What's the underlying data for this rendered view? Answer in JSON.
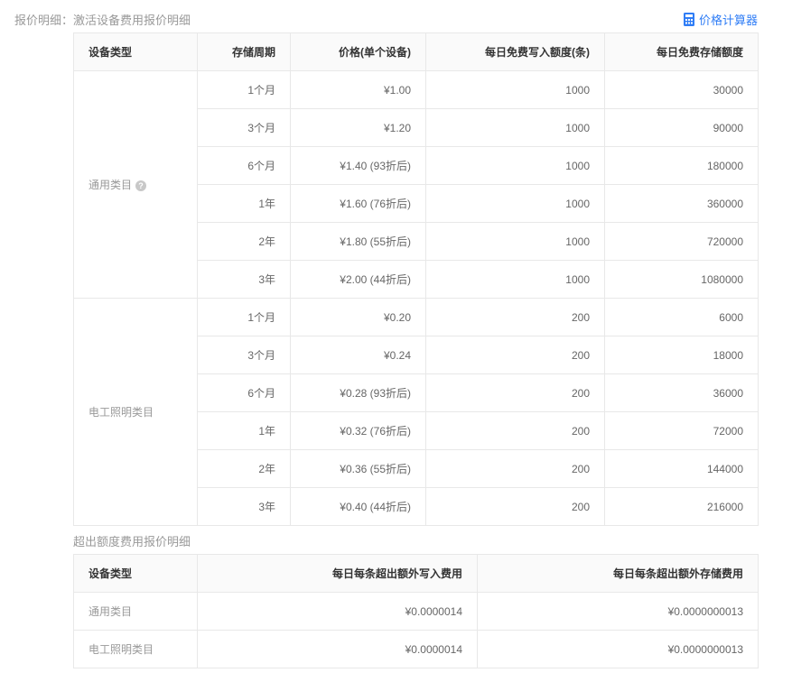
{
  "header": {
    "label": "报价明细：激活设备费用报价明细",
    "calculator": "价格计算器",
    "calculator_icon": "calculator-icon",
    "accent": "#2f7df6"
  },
  "main_table": {
    "columns": [
      "设备类型",
      "存储周期",
      "价格(单个设备)",
      "每日免费写入额度(条)",
      "每日免费存储额度"
    ],
    "groups": [
      {
        "category": "通用类目",
        "help_icon": "question-icon",
        "rows": [
          {
            "period": "1个月",
            "price": "¥1.00",
            "write": "1000",
            "storage": "30000"
          },
          {
            "period": "3个月",
            "price": "¥1.20",
            "write": "1000",
            "storage": "90000"
          },
          {
            "period": "6个月",
            "price": "¥1.40 (93折后)",
            "write": "1000",
            "storage": "180000"
          },
          {
            "period": "1年",
            "price": "¥1.60 (76折后)",
            "write": "1000",
            "storage": "360000"
          },
          {
            "period": "2年",
            "price": "¥1.80 (55折后)",
            "write": "1000",
            "storage": "720000"
          },
          {
            "period": "3年",
            "price": "¥2.00 (44折后)",
            "write": "1000",
            "storage": "1080000"
          }
        ]
      },
      {
        "category": "电工照明类目",
        "rows": [
          {
            "period": "1个月",
            "price": "¥0.20",
            "write": "200",
            "storage": "6000"
          },
          {
            "period": "3个月",
            "price": "¥0.24",
            "write": "200",
            "storage": "18000"
          },
          {
            "period": "6个月",
            "price": "¥0.28 (93折后)",
            "write": "200",
            "storage": "36000"
          },
          {
            "period": "1年",
            "price": "¥0.32 (76折后)",
            "write": "200",
            "storage": "72000"
          },
          {
            "period": "2年",
            "price": "¥0.36 (55折后)",
            "write": "200",
            "storage": "144000"
          },
          {
            "period": "3年",
            "price": "¥0.40 (44折后)",
            "write": "200",
            "storage": "216000"
          }
        ]
      }
    ]
  },
  "overage": {
    "title": "超出额度费用报价明细",
    "columns": [
      "设备类型",
      "每日每条超出额外写入费用",
      "每日每条超出额外存储费用"
    ],
    "rows": [
      {
        "category": "通用类目",
        "write_fee": "¥0.0000014",
        "storage_fee": "¥0.0000000013"
      },
      {
        "category": "电工照明类目",
        "write_fee": "¥0.0000014",
        "storage_fee": "¥0.0000000013"
      }
    ]
  }
}
